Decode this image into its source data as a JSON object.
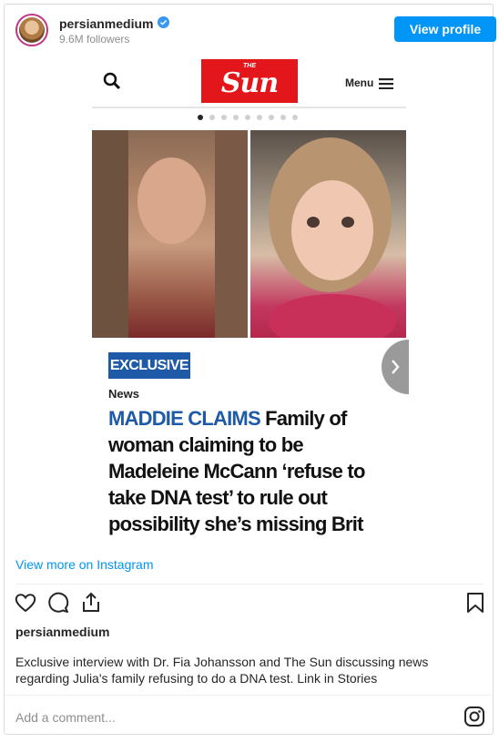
{
  "header": {
    "username": "persianmedium",
    "followers": "9.6M followers",
    "view_profile_label": "View profile"
  },
  "media": {
    "logo_small": "THE",
    "logo_text": "Sun",
    "menu_label": "Menu",
    "carousel_total": 9,
    "carousel_active": 1,
    "tag_label": "EXCLUSIVE",
    "section_label": "News",
    "headline_kicker": "MADDIE CLAIMS",
    "headline_rest": "Family of woman claiming to be Madeleine McCann ‘refuse to take DNA test’ to rule out possibility she’s missing Brit"
  },
  "links": {
    "view_more": "View more on Instagram"
  },
  "post": {
    "poster": "persianmedium",
    "caption": "Exclusive interview with Dr. Fia Johansson and The Sun discussing news regarding Julia's family refusing to do a DNA test. Link in Stories"
  },
  "comment": {
    "placeholder": "Add a comment..."
  },
  "colors": {
    "accent": "#0095f6",
    "sun_red": "#e3161b",
    "tag_blue": "#1e5aa8"
  },
  "icons": [
    "search-icon",
    "menu-icon",
    "chevron-right-icon",
    "heart-icon",
    "comment-icon",
    "share-icon",
    "bookmark-icon",
    "instagram-icon",
    "verified-icon"
  ]
}
